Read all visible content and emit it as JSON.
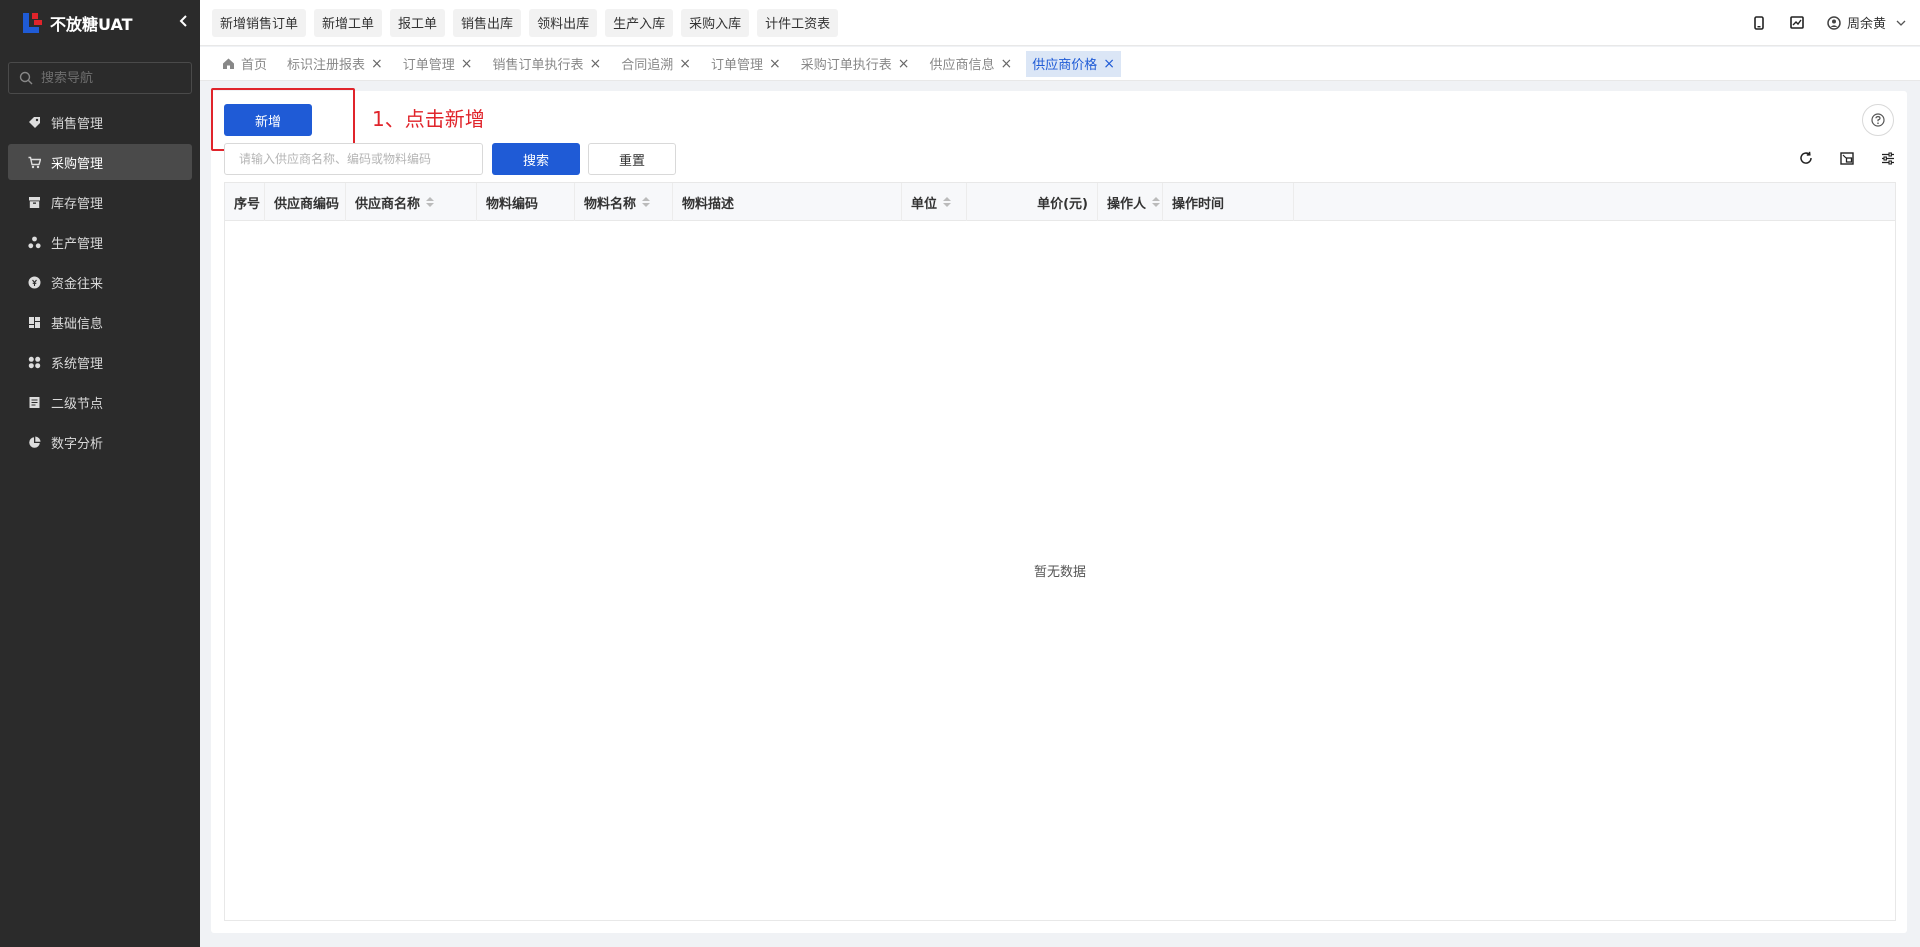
{
  "app": {
    "title": "不放糖UAT"
  },
  "sidebar": {
    "search_placeholder": "搜索导航",
    "items": [
      {
        "label": "销售管理",
        "icon": "tag-icon"
      },
      {
        "label": "采购管理",
        "icon": "cart-icon",
        "active": true
      },
      {
        "label": "库存管理",
        "icon": "box-icon"
      },
      {
        "label": "生产管理",
        "icon": "nodes-icon"
      },
      {
        "label": "资金往来",
        "icon": "coin-icon"
      },
      {
        "label": "基础信息",
        "icon": "grid-icon"
      },
      {
        "label": "系统管理",
        "icon": "apps-icon"
      },
      {
        "label": "二级节点",
        "icon": "doc-icon"
      },
      {
        "label": "数字分析",
        "icon": "pie-icon"
      }
    ]
  },
  "topbar": {
    "quick_buttons": [
      "新增销售订单",
      "新增工单",
      "报工单",
      "销售出库",
      "领料出库",
      "生产入库",
      "采购入库",
      "计件工资表"
    ],
    "user_name": "周余黄"
  },
  "tabs": [
    {
      "label": "首页",
      "home": true
    },
    {
      "label": "标识注册报表"
    },
    {
      "label": "订单管理"
    },
    {
      "label": "销售订单执行表"
    },
    {
      "label": "合同追溯"
    },
    {
      "label": "订单管理"
    },
    {
      "label": "采购订单执行表"
    },
    {
      "label": "供应商信息"
    },
    {
      "label": "供应商价格",
      "active": true
    }
  ],
  "toolbar": {
    "add_label": "新增",
    "annotation": "1、点击新增",
    "search_placeholder": "请输入供应商名称、编码或物料编码",
    "search_label": "搜索",
    "reset_label": "重置"
  },
  "table": {
    "columns": [
      {
        "label": "序号",
        "sortable": false
      },
      {
        "label": "供应商编码",
        "sortable": false
      },
      {
        "label": "供应商名称",
        "sortable": true
      },
      {
        "label": "物料编码",
        "sortable": false
      },
      {
        "label": "物料名称",
        "sortable": true
      },
      {
        "label": "物料描述",
        "sortable": false
      },
      {
        "label": "单位",
        "sortable": true
      },
      {
        "label": "单价(元)",
        "sortable": false
      },
      {
        "label": "操作人",
        "sortable": true
      },
      {
        "label": "操作时间",
        "sortable": false
      }
    ],
    "rows": [],
    "empty_text": "暂无数据"
  },
  "colors": {
    "primary": "#1f5bd6",
    "annotation": "#e0242b",
    "sidebar_bg": "#2b2b2b"
  }
}
